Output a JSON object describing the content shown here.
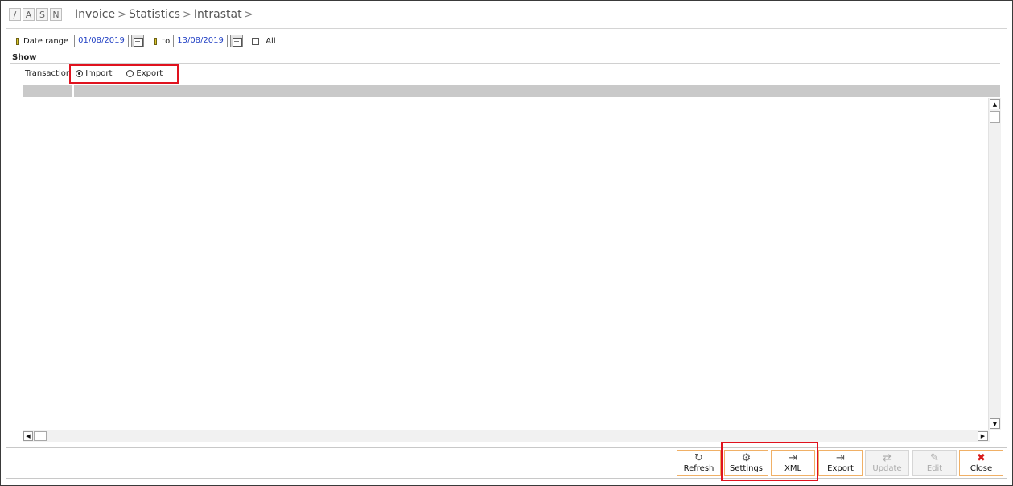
{
  "header": {
    "mode_buttons": [
      "/",
      "A",
      "S",
      "N"
    ],
    "breadcrumb": [
      "Invoice",
      "Statistics",
      "Intrastat"
    ],
    "separator": ">"
  },
  "filters": {
    "date_range_label": "Date range",
    "date_from": "01/08/2019",
    "to_label": "to",
    "date_to": "13/08/2019",
    "all_label": "All",
    "all_checked": false
  },
  "show": {
    "section_label": "Show",
    "transaction_label": "Transaction",
    "options": [
      "Import",
      "Export"
    ],
    "selected": "Import"
  },
  "grid": {
    "columns": [
      "",
      ""
    ],
    "rows": []
  },
  "toolbar": {
    "refresh": {
      "label": "Refresh",
      "icon": "refresh-icon",
      "enabled": true
    },
    "settings": {
      "label": "Settings",
      "icon": "gear-icon",
      "enabled": true
    },
    "xml": {
      "label": "XML",
      "icon": "export-file-icon",
      "enabled": true
    },
    "export": {
      "label": "Export",
      "icon": "export-file-icon",
      "enabled": true
    },
    "update": {
      "label": "Update",
      "icon": "sync-icon",
      "enabled": false
    },
    "edit": {
      "label": "Edit",
      "icon": "pencil-icon",
      "enabled": false
    },
    "close": {
      "label": "Close",
      "icon": "close-icon",
      "enabled": true
    }
  },
  "colors": {
    "highlight": "#e0121e",
    "button_border": "#f0b066",
    "date_text": "#2241c4",
    "grid_header": "#c9c9c9"
  }
}
